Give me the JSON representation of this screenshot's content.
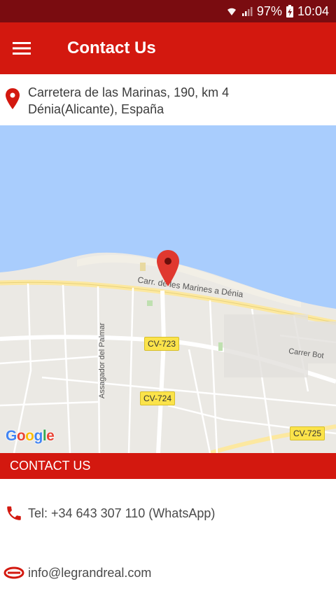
{
  "status_bar": {
    "battery": "97%",
    "time": "10:04",
    "icons": [
      "wifi-icon",
      "signal-icon",
      "battery-charging-icon"
    ]
  },
  "app_bar": {
    "title": "Contact Us",
    "menu_icon": "hamburger-menu-icon"
  },
  "address": {
    "line1": "Carretera de las Marinas, 190, km 4",
    "line2": "Dénia(Alicante), España",
    "icon": "location-pin-icon"
  },
  "map": {
    "road_labels": {
      "main_road": "Carr. de les Marines a Dénia",
      "side_road": "Assagador del Palmar",
      "carrer": "Carrer Bot"
    },
    "shields": [
      "CV-723",
      "CV-724",
      "CV-725"
    ],
    "logo": "Google",
    "colors": {
      "water": "#a9cdfd",
      "land": "#ebe9e4",
      "road": "#ffffff",
      "arterial": "#fce8a0",
      "pin": "#e0382f"
    }
  },
  "contact": {
    "header": "CONTACT US",
    "phone": "Tel: +34 643 307 110 (WhatsApp)",
    "email": "info@legrandreal.com"
  },
  "colors": {
    "status_bar": "#7a0c10",
    "primary": "#d3180f"
  }
}
